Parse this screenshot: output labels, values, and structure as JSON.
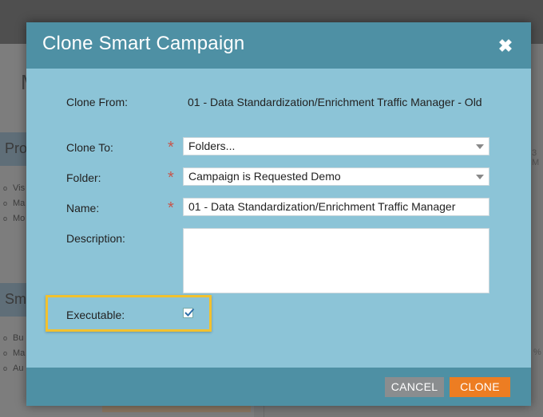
{
  "background": {
    "title_fragment": "M",
    "sections": [
      {
        "label": "Pro",
        "items": [
          "Vis",
          "Ma",
          "Mo"
        ]
      },
      {
        "label": "Sm",
        "items": [
          "Bu",
          "Ma",
          "Au"
        ]
      }
    ],
    "right_fragments": [
      "3 M",
      "%"
    ]
  },
  "dialog": {
    "title": "Clone Smart Campaign",
    "close_icon": "close-icon",
    "fields": {
      "clone_from": {
        "label": "Clone From:",
        "value": "01 - Data Standardization/Enrichment Traffic Manager - Old"
      },
      "clone_to": {
        "label": "Clone To:",
        "value": "Folders..."
      },
      "folder": {
        "label": "Folder:",
        "value": "Campaign is Requested Demo"
      },
      "name": {
        "label": "Name:",
        "value": "01 - Data Standardization/Enrichment Traffic Manager"
      },
      "description": {
        "label": "Description:",
        "value": ""
      },
      "executable": {
        "label": "Executable:",
        "checked": true
      }
    },
    "required_marker": "*",
    "buttons": {
      "cancel": "CANCEL",
      "clone": "CLONE"
    }
  },
  "colors": {
    "header": "#4e90a4",
    "body": "#8cc4d7",
    "clone_button": "#ed7d22",
    "cancel_button": "#8a8d8f",
    "highlight": "#f2c12e",
    "required": "#c8554a"
  }
}
